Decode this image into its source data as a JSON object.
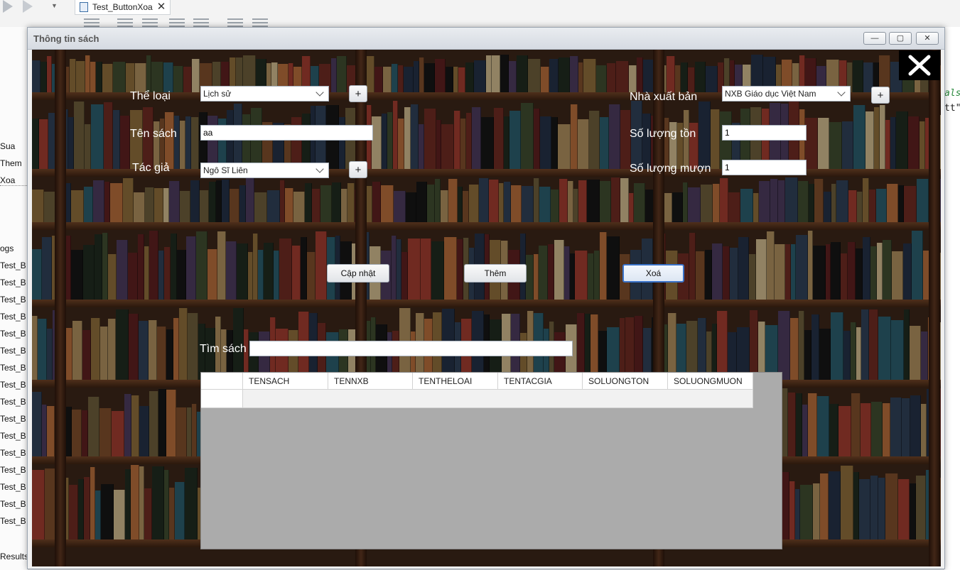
{
  "ide": {
    "tab_label": "Test_ButtonXoa",
    "left_panel": [
      "Sua",
      "Them",
      "Xoa",
      "ogs",
      "Test_B",
      "Test_B",
      "Test_B",
      "Test_B",
      "Test_B",
      "Test_B",
      "Test_B",
      "Test_B",
      "Test_B",
      "Test_B",
      "Test_B",
      "Test_B",
      "Test_B",
      "Test_B",
      "Test_B",
      "Test_B"
    ],
    "results_label": "Results",
    "code_fragments": [
      "als",
      "tt\""
    ]
  },
  "dialog": {
    "title": "Thông tin sách",
    "window_buttons": {
      "minimize": "—",
      "maximize": "▢",
      "close": "✕"
    }
  },
  "form": {
    "the_loai": {
      "label": "Thể loại",
      "value": "Lịch sử"
    },
    "ten_sach": {
      "label": "Tên sách",
      "value": "aa"
    },
    "tac_gia": {
      "label": "Tác giả",
      "value": "Ngô Sĩ Liên"
    },
    "nha_xuat_ban": {
      "label": "Nhà xuất bản",
      "value": "NXB Giáo dục Việt Nam"
    },
    "so_luong_ton": {
      "label": "Số lượng tồn",
      "value": "1"
    },
    "so_luong_muon": {
      "label": "Số lượng mượn",
      "value": "1"
    },
    "plus_label": "+"
  },
  "actions": {
    "cap_nhat": "Cập nhật",
    "them": "Thêm",
    "xoa": "Xoá"
  },
  "search": {
    "label": "Tìm sách",
    "value": ""
  },
  "grid": {
    "columns": [
      "TENSACH",
      "TENNXB",
      "TENTHELOAI",
      "TENTACGIA",
      "SOLUONGTON",
      "SOLUONGMUON"
    ]
  },
  "colors": {
    "focus_border": "#3a72c8",
    "shelf_wood": "#3a2418",
    "grid_empty": "#ababab"
  }
}
